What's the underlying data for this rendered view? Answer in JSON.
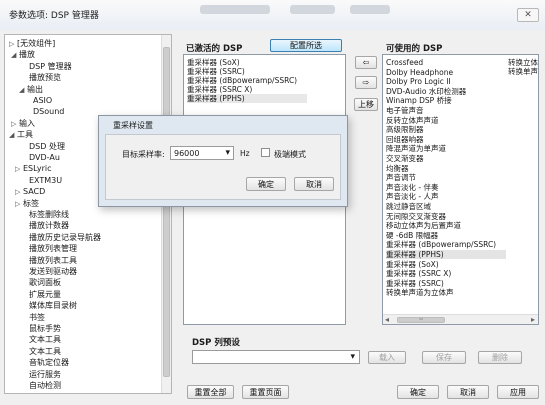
{
  "window": {
    "title": "参数选项: DSP 管理器",
    "close_glyph": "✕"
  },
  "tree": {
    "items": [
      {
        "label": "[无效组件]",
        "expander": "▷"
      },
      {
        "label": "播放",
        "expander": "◢"
      },
      {
        "label": "DSP 管理器",
        "expander": ""
      },
      {
        "label": "播放预览",
        "expander": ""
      },
      {
        "label": "输出",
        "expander": "◢"
      },
      {
        "label": "ASIO",
        "expander": ""
      },
      {
        "label": "DSound",
        "expander": ""
      },
      {
        "label": "输入",
        "expander": "▷"
      },
      {
        "label": "工具",
        "expander": "◢"
      },
      {
        "label": "DSD 处理",
        "expander": ""
      },
      {
        "label": "DVD-Au",
        "expander": ""
      },
      {
        "label": "ESLyric",
        "expander": "▷"
      },
      {
        "label": "EXTM3U",
        "expander": ""
      },
      {
        "label": "SACD",
        "expander": "▷"
      },
      {
        "label": "标签",
        "expander": "▷"
      },
      {
        "label": "标签删除线",
        "expander": ""
      },
      {
        "label": "播放计数器",
        "expander": ""
      },
      {
        "label": "播放历史记录导航器",
        "expander": ""
      },
      {
        "label": "播放列表管理",
        "expander": ""
      },
      {
        "label": "播放列表工具",
        "expander": ""
      },
      {
        "label": "发送到驱动器",
        "expander": ""
      },
      {
        "label": "歌词面板",
        "expander": ""
      },
      {
        "label": "扩展元量",
        "expander": ""
      },
      {
        "label": "媒体库目录树",
        "expander": ""
      },
      {
        "label": "书签",
        "expander": ""
      },
      {
        "label": "鼠标手势",
        "expander": ""
      },
      {
        "label": "文本工具",
        "expander": ""
      },
      {
        "label": "文本工具",
        "expander": ""
      },
      {
        "label": "音轨定位器",
        "expander": ""
      },
      {
        "label": "运行服务",
        "expander": ""
      },
      {
        "label": "自动检测",
        "expander": ""
      }
    ]
  },
  "active_dsp": {
    "label": "已激活的 DSP",
    "configure_button": "配置所选",
    "items": [
      "重采样器 (SoX)",
      "重采样器 (SSRC)",
      "重采样器 (dBpoweramp/SSRC)",
      "重采样器 (SSRC X)",
      "重采样器 (PPHS)"
    ]
  },
  "move_buttons": {
    "left": "⇦",
    "right": "⇨",
    "up": "上移"
  },
  "available_dsp": {
    "label": "可使用的 DSP",
    "items": [
      "Crossfeed",
      "Dolby Headphone",
      "Dolby Pro Logic II",
      "DVD-Audio 水印检测器",
      "Winamp DSP 桥接",
      "电子管声音",
      "反转立体声声道",
      "高级限制器",
      "回组器响器",
      "降混声道为单声道",
      "交叉渐变器",
      "均衡器",
      "声音调节",
      "声音淡化 - 伴奏",
      "声音淡化 - 人声",
      "跳过静音区域",
      "无间隙交叉渐变器",
      "移动立体声为后置声道",
      "硬 -6dB 限幅器",
      "重采样器 (dBpoweramp/SSRC)",
      "重采样器 (PPHS)",
      "重采样器 (SoX)",
      "重采样器 (SSRC X)",
      "重采样器 (SSRC)",
      "转换单声道为立体声"
    ],
    "right_col": [
      "转换立体",
      "转换单声"
    ],
    "hscroll_left": "◂",
    "hscroll_right": "▸",
    "hscroll_grip": "┅"
  },
  "presets": {
    "label": "DSP 列预设",
    "dropdown_arrow": "▾",
    "load": "载入",
    "save": "保存",
    "delete": "删除"
  },
  "footer": {
    "reset_all": "重置全部",
    "reset_page": "重置页面",
    "ok": "确定",
    "cancel": "取消",
    "apply": "应用"
  },
  "dialog": {
    "title": "重采样设置",
    "rate_label": "目标采样率:",
    "rate_value": "96000",
    "rate_arrow": "▾",
    "unit": "Hz",
    "ultra_mode": "极端模式",
    "ok": "确定",
    "cancel": "取消"
  }
}
